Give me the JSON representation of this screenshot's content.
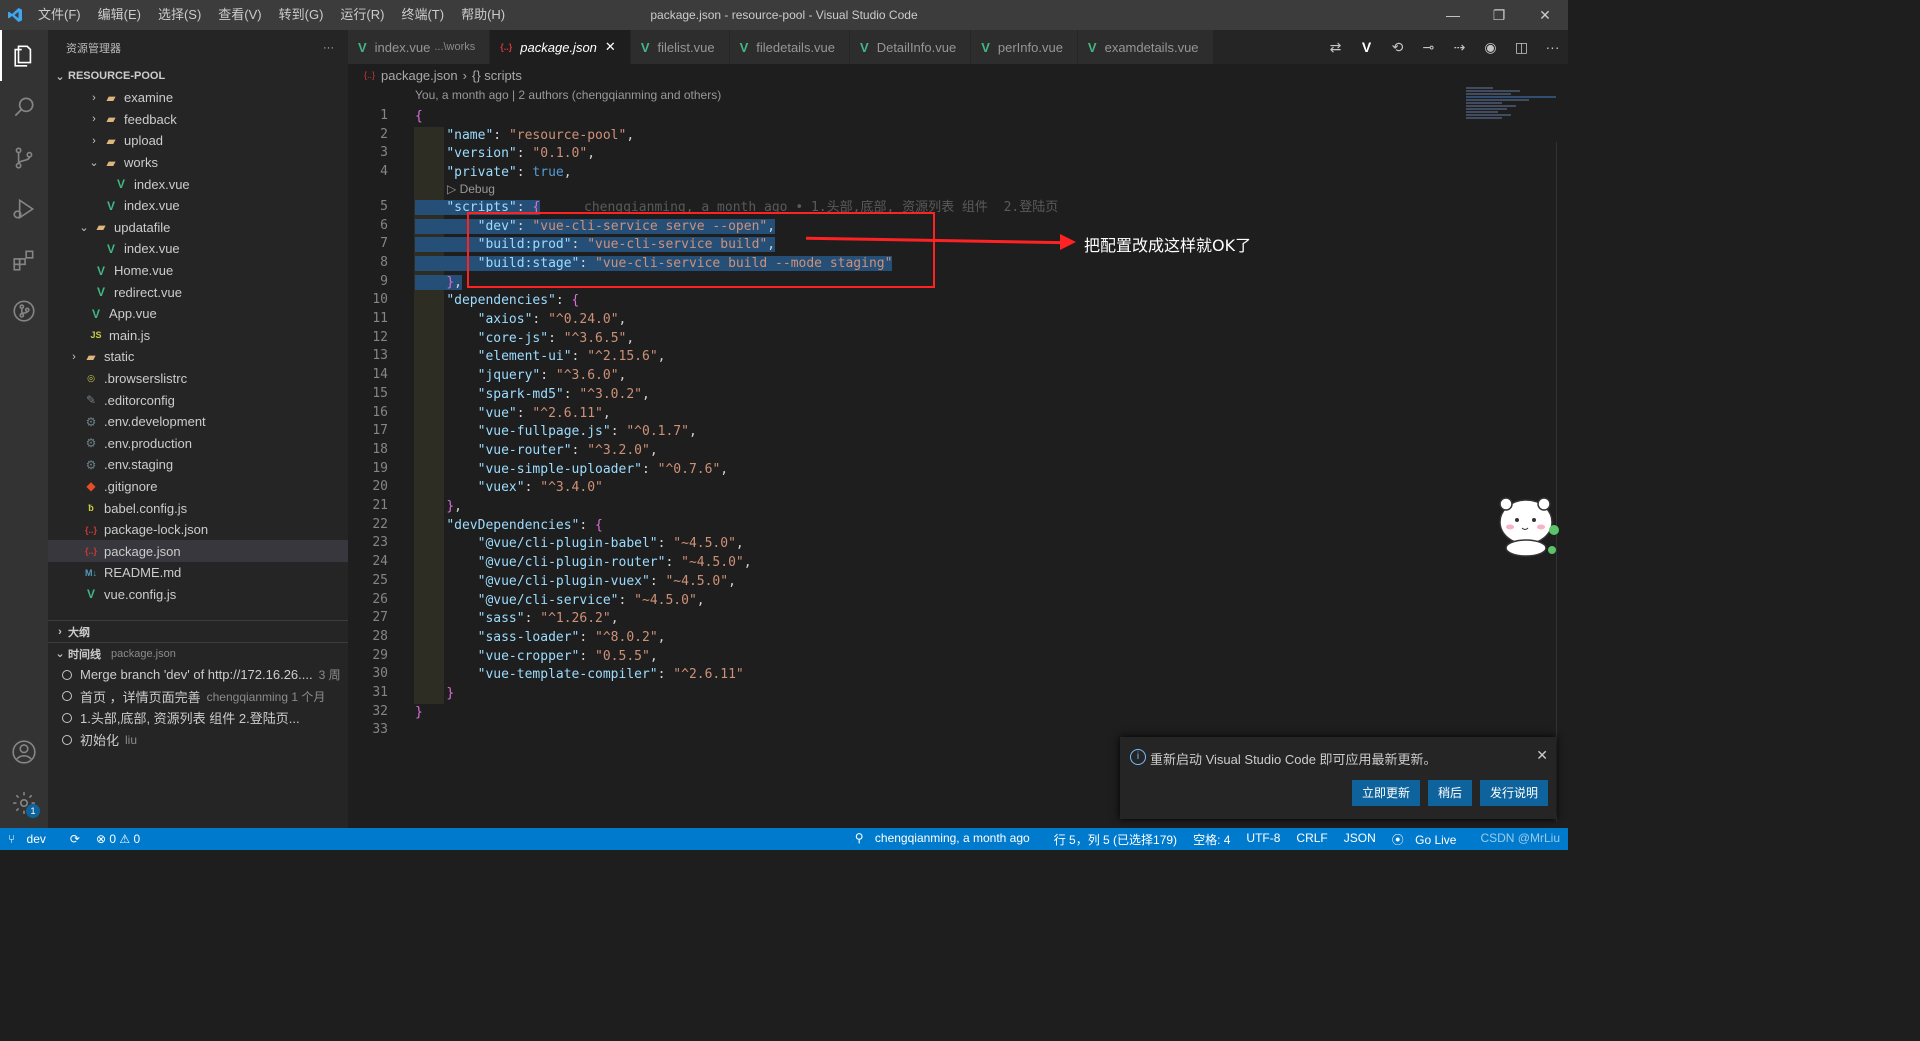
{
  "titlebar": {
    "title": "package.json - resource-pool - Visual Studio Code",
    "menu": [
      "文件(F)",
      "编辑(E)",
      "选择(S)",
      "查看(V)",
      "转到(G)",
      "运行(R)",
      "终端(T)",
      "帮助(H)"
    ]
  },
  "sidebar": {
    "header": "资源管理器",
    "more": "···",
    "root": "RESOURCE-POOL",
    "tree": [
      {
        "label": "examine",
        "type": "folder",
        "depth": 2,
        "chev": "›"
      },
      {
        "label": "feedback",
        "type": "folder",
        "depth": 2,
        "chev": "›"
      },
      {
        "label": "upload",
        "type": "folder",
        "depth": 2,
        "chev": "›"
      },
      {
        "label": "works",
        "type": "folder",
        "depth": 2,
        "chev": "⌄"
      },
      {
        "label": "index.vue",
        "type": "vue",
        "depth": 3
      },
      {
        "label": "index.vue",
        "type": "vue",
        "depth": 2
      },
      {
        "label": "updatafile",
        "type": "folder",
        "depth": 1,
        "chev": "⌄"
      },
      {
        "label": "index.vue",
        "type": "vue",
        "depth": 2
      },
      {
        "label": "Home.vue",
        "type": "vue",
        "depth": 1
      },
      {
        "label": "redirect.vue",
        "type": "vue",
        "depth": 1
      },
      {
        "label": "App.vue",
        "type": "vue",
        "depth": 0.5
      },
      {
        "label": "main.js",
        "type": "js",
        "depth": 0.5
      },
      {
        "label": "static",
        "type": "folder",
        "depth": 0,
        "chev": "›"
      },
      {
        "label": ".browserslistrc",
        "type": "browsers",
        "depth": 0
      },
      {
        "label": ".editorconfig",
        "type": "editorconfig",
        "depth": 0
      },
      {
        "label": ".env.development",
        "type": "gear",
        "depth": 0
      },
      {
        "label": ".env.production",
        "type": "gear",
        "depth": 0
      },
      {
        "label": ".env.staging",
        "type": "gear",
        "depth": 0
      },
      {
        "label": ".gitignore",
        "type": "git",
        "depth": 0
      },
      {
        "label": "babel.config.js",
        "type": "babel",
        "depth": 0
      },
      {
        "label": "package-lock.json",
        "type": "json",
        "depth": 0
      },
      {
        "label": "package.json",
        "type": "json",
        "depth": 0,
        "selected": true
      },
      {
        "label": "README.md",
        "type": "md",
        "depth": 0
      },
      {
        "label": "vue.config.js",
        "type": "vue",
        "depth": 0
      }
    ],
    "outline_label": "大纲",
    "timeline_label": "时间线",
    "timeline_file": "package.json",
    "timeline": [
      {
        "label": "Merge branch 'dev' of http://172.16.26....",
        "meta": "3 周"
      },
      {
        "label": "首页 ，详情页面完善",
        "meta": "chengqianming   1 个月"
      },
      {
        "label": "1.头部,底部, 资源列表 组件 2.登陆页...",
        "meta": ""
      },
      {
        "label": "初始化",
        "meta": "liu"
      }
    ]
  },
  "tabs": [
    {
      "label": "index.vue",
      "desc": "...\\works",
      "icon": "vue"
    },
    {
      "label": "package.json",
      "desc": "",
      "icon": "json",
      "active": true
    },
    {
      "label": "filelist.vue",
      "desc": "",
      "icon": "vue"
    },
    {
      "label": "filedetails.vue",
      "desc": "",
      "icon": "vue"
    },
    {
      "label": "DetailInfo.vue",
      "desc": "",
      "icon": "vue"
    },
    {
      "label": "perInfo.vue",
      "desc": "",
      "icon": "vue"
    },
    {
      "label": "examdetails.vue",
      "desc": "",
      "icon": "vue"
    }
  ],
  "breadcrumb": {
    "file": "package.json",
    "sep": "›",
    "symbol": "{} scripts"
  },
  "codelens": {
    "authors": "You, a month ago | 2 authors (chengqianming and others)",
    "debug": "▷ Debug"
  },
  "blame": "chengqianming, a month ago • 1.头部,底部, 资源列表 组件  2.登陆页",
  "code_lines": [
    "{",
    "    \"name\": \"resource-pool\",",
    "    \"version\": \"0.1.0\",",
    "    \"private\": true,",
    "    \"scripts\": {",
    "        \"dev\": \"vue-cli-service serve --open\",",
    "        \"build:prod\": \"vue-cli-service build\",",
    "        \"build:stage\": \"vue-cli-service build --mode staging\"",
    "    },",
    "    \"dependencies\": {",
    "        \"axios\": \"^0.24.0\",",
    "        \"core-js\": \"^3.6.5\",",
    "        \"element-ui\": \"^2.15.6\",",
    "        \"jquery\": \"^3.6.0\",",
    "        \"spark-md5\": \"^3.0.2\",",
    "        \"vue\": \"^2.6.11\",",
    "        \"vue-fullpage.js\": \"^0.1.7\",",
    "        \"vue-router\": \"^3.2.0\",",
    "        \"vue-simple-uploader\": \"^0.7.6\",",
    "        \"vuex\": \"^3.4.0\"",
    "    },",
    "    \"devDependencies\": {",
    "        \"@vue/cli-plugin-babel\": \"~4.5.0\",",
    "        \"@vue/cli-plugin-router\": \"~4.5.0\",",
    "        \"@vue/cli-plugin-vuex\": \"~4.5.0\",",
    "        \"@vue/cli-service\": \"~4.5.0\",",
    "        \"sass\": \"^1.26.2\",",
    "        \"sass-loader\": \"^8.0.2\",",
    "        \"vue-cropper\": \"0.5.5\",",
    "        \"vue-template-compiler\": \"^2.6.11\"",
    "    }",
    "}",
    ""
  ],
  "annotation": "把配置改成这样就OK了",
  "notification": {
    "message": "重新启动 Visual Studio Code 即可应用最新更新。",
    "close": "✕",
    "buttons": [
      "立即更新",
      "稍后",
      "发行说明"
    ]
  },
  "statusbar": {
    "branch": "dev",
    "sync": "⟳",
    "problems": "⊗ 0 ⚠ 0",
    "blame": "chengqianming, a month ago",
    "position": "行 5，列 5 (已选择179)",
    "spaces": "空格: 4",
    "encoding": "UTF-8",
    "eol": "CRLF",
    "language": "JSON",
    "golive": "Go Live",
    "watermark": "CSDN @MrLiu"
  },
  "colors": {
    "accent": "#007acc",
    "annotation_red": "#ff2222",
    "vue": "#41b883",
    "selection": "#264f78"
  }
}
